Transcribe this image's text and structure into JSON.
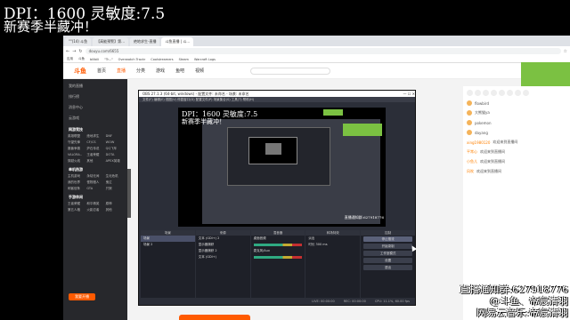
{
  "overlay": {
    "dpi": "DPI：1600 灵敏度:7.5",
    "slogan": "新赛季半藏冲！"
  },
  "browser": {
    "tabs": [
      "\"\"(14) 斗鱼",
      "【高能预警】第... ",
      "绝地求生-直播",
      "斗鱼直播 | 斗..."
    ],
    "url": "douyu.com/6655",
    "bookmarks": [
      "应用",
      "斗鱼",
      "bilibili",
      "\"Tr...\"",
      "Overwatch Trackr",
      "Coolstreamers",
      "Steam",
      "Warcraft Logs"
    ],
    "nav": {
      "logo": "斗鱼",
      "items": [
        "首页",
        "直播",
        "分类",
        "游戏",
        "鱼吧",
        "视频"
      ],
      "active": "直播"
    },
    "sidebar": {
      "items": [
        "我的直播",
        "排行榜",
        "消息中心",
        "云游戏"
      ],
      "sections": [
        {
          "title": "网游竞技",
          "grid": [
            "英雄联盟",
            "绝地求生",
            "DNF",
            "守望先锋",
            "CF/CS",
            "WOW",
            "魔兽争霸",
            "炉石传说",
            "QQ飞车",
            "VALORA..",
            "王者荣耀",
            "DOTA",
            "穿越火线",
            "其他",
            "APEX英雄"
          ]
        },
        {
          "title": "单机热游",
          "grid": [
            "主机游戏",
            "永劫无间",
            "生化危机",
            "我的世界",
            "怪物猎人",
            "鬼泣",
            "刺客信条",
            "GTA",
            "只狼"
          ]
        },
        {
          "title": "手游休闲",
          "grid": [
            "王者荣耀",
            "和平精英",
            "原神",
            "第五人格",
            "火影忍者",
            "其他"
          ]
        }
      ],
      "live_button": "我要开播"
    },
    "chat": {
      "lines": [
        {
          "user": "flowbird",
          "text": ""
        },
        {
          "user": "大熊猫ya",
          "text": ""
        },
        {
          "user": "pokemon",
          "text": ""
        },
        {
          "user": "dayang",
          "text": ""
        },
        {
          "user": "xing1980120",
          "text": "欢迎来到直播间"
        },
        {
          "user": "平常心",
          "text": "欢迎来到直播间"
        },
        {
          "user": "小鱼儿",
          "text": "欢迎来到直播间"
        },
        {
          "user": "风吹",
          "text": "欢迎来到直播间"
        }
      ]
    }
  },
  "obs": {
    "title": "OBS 27.1.3 (64-bit, windows) - 配置文件: 未命名 - 场景: 未命名",
    "menu": "文件(F)  编辑(E)  视图(V)  停靠窗口(D)  配置文件(P)  场景集合(S)  工具(T)  帮助(H)",
    "preview_dpi": "DPI：1600 灵敏度:7.5",
    "preview_slogan": "新赛季半藏冲！",
    "preview_notice": "直播通知群:627918776",
    "scenes": {
      "header": "场景",
      "rows": [
        "场景",
        "场景 2"
      ]
    },
    "sources": {
      "header": "来源",
      "rows": [
        "文本 (GDI+) 2",
        "显示器捕获",
        "显示器捕获 2",
        "文本 (GDI+)"
      ]
    },
    "mixer": {
      "header": "混音器",
      "rows": [
        "桌面音频",
        "麦克风/Aux"
      ]
    },
    "transitions": {
      "header": "转场特效",
      "rows": [
        "淡出",
        "时长 300 ms"
      ]
    },
    "controls": {
      "header": "控制",
      "buttons": [
        "停止推流",
        "开始录制",
        "工作室模式",
        "设置",
        "退出"
      ],
      "selected": "停止推流"
    },
    "status": [
      "LIVE: 00:00:00",
      "REC: 00:00:00",
      "CPU: 11.1%, 60.00 fps"
    ]
  },
  "notice": {
    "group": "直播通知群:627918776",
    "douyu": "@斗鱼、帝宸清羽",
    "music": "网易云音乐:帝宸清羽"
  }
}
